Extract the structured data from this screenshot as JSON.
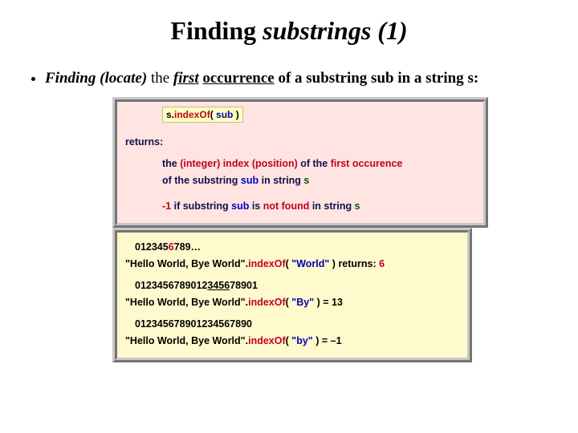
{
  "title": {
    "pre": "Finding ",
    "italic": "substrings (1)"
  },
  "bullet": {
    "lead": "Finding (locate)",
    "mid1": " the ",
    "first": "first",
    "mid2": " ",
    "occ": "occurrence",
    "mid3": " of a substring ",
    "sub": "sub",
    "mid4": " in a string ",
    "s": "s:"
  },
  "pink": {
    "chip": {
      "s": "s.",
      "method": "indexOf",
      "open": "( ",
      "arg": "sub",
      "close": " )"
    },
    "returns": "returns:",
    "line1_a": "the ",
    "line1_b": "(integer) index (position)",
    "line1_c": " of the ",
    "line1_d": "first occurence",
    "line2_a": "of the substring ",
    "line2_b": "sub",
    "line2_c": " in string ",
    "line2_d": "s",
    "line3_a": "-1",
    "line3_b": " if substring ",
    "line3_c": "sub",
    "line3_d": " is ",
    "line3_e": "not found",
    "line3_f": " in string ",
    "line3_g": "s"
  },
  "yellow": {
    "ex1": {
      "idxline_plain": "012345",
      "idxline_red": "6",
      "idxline_tail": "789…",
      "str": "\"Hello World, Bye World\"",
      "dot": ".",
      "method": "indexOf",
      "open": "(",
      "arg": " \"World\" ",
      "close": ")   ",
      "ret": "returns: ",
      "val": "6"
    },
    "ex2": {
      "idxline": "012345678901234567890",
      "idxunderline_pos": "2345",
      "str": "\"Hello World, Bye World\"",
      "dot": ".",
      "method": "indexOf",
      "open": "(",
      "arg": " \"By\" ",
      "close": ") = 13"
    },
    "ex3": {
      "idxline": "012345678901234567890",
      "idxunderline_pos": "1",
      "str": "\"Hello World, Bye World\"",
      "dot": ".",
      "method": "indexOf",
      "open": "(",
      "arg": " \"by\" ",
      "close": ") = –1"
    }
  }
}
